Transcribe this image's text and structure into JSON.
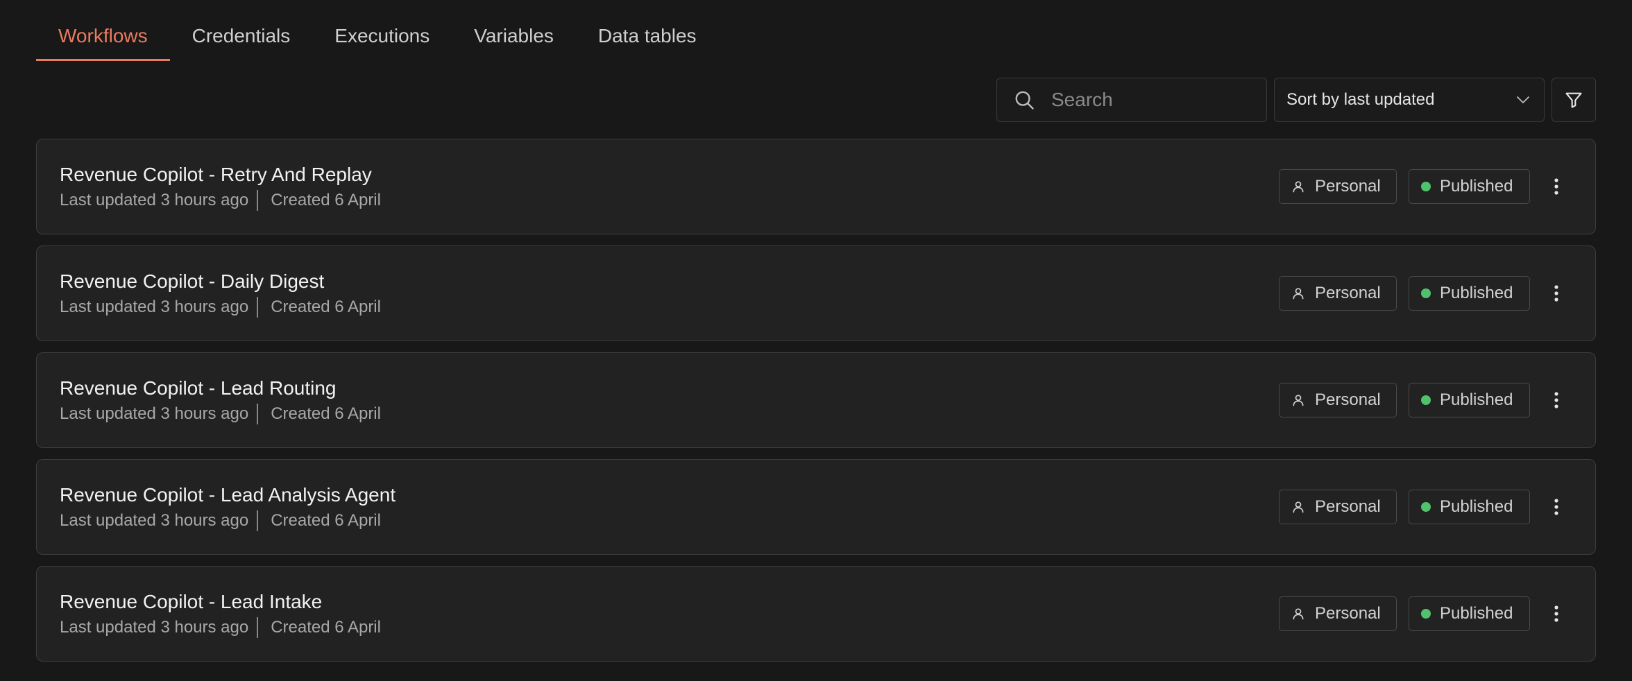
{
  "tabs": [
    "Workflows",
    "Credentials",
    "Executions",
    "Variables",
    "Data tables"
  ],
  "active_tab": "Workflows",
  "search": {
    "placeholder": "Search",
    "value": ""
  },
  "sort": {
    "selected": "Sort by last updated"
  },
  "workflows": [
    {
      "title": "Revenue Copilot - Retry And Replay",
      "updated": "Last updated 3 hours ago",
      "created": "Created 6 April",
      "owner": "Personal",
      "status": "Published"
    },
    {
      "title": "Revenue Copilot - Daily Digest",
      "updated": "Last updated 3 hours ago",
      "created": "Created 6 April",
      "owner": "Personal",
      "status": "Published"
    },
    {
      "title": "Revenue Copilot - Lead Routing",
      "updated": "Last updated 3 hours ago",
      "created": "Created 6 April",
      "owner": "Personal",
      "status": "Published"
    },
    {
      "title": "Revenue Copilot - Lead Analysis Agent",
      "updated": "Last updated 3 hours ago",
      "created": "Created 6 April",
      "owner": "Personal",
      "status": "Published"
    },
    {
      "title": "Revenue Copilot - Lead Intake",
      "updated": "Last updated 3 hours ago",
      "created": "Created 6 April",
      "owner": "Personal",
      "status": "Published"
    }
  ],
  "colors": {
    "accent": "#ea7b5f",
    "background": "#181818",
    "card": "#222222",
    "published": "#4fc26b"
  },
  "icons": {
    "search": "search-icon",
    "sort_dropdown": "chevron-down-icon",
    "filter": "filter-icon",
    "owner": "user-icon",
    "status": "status-dot-icon",
    "menu": "more-vertical-icon"
  }
}
